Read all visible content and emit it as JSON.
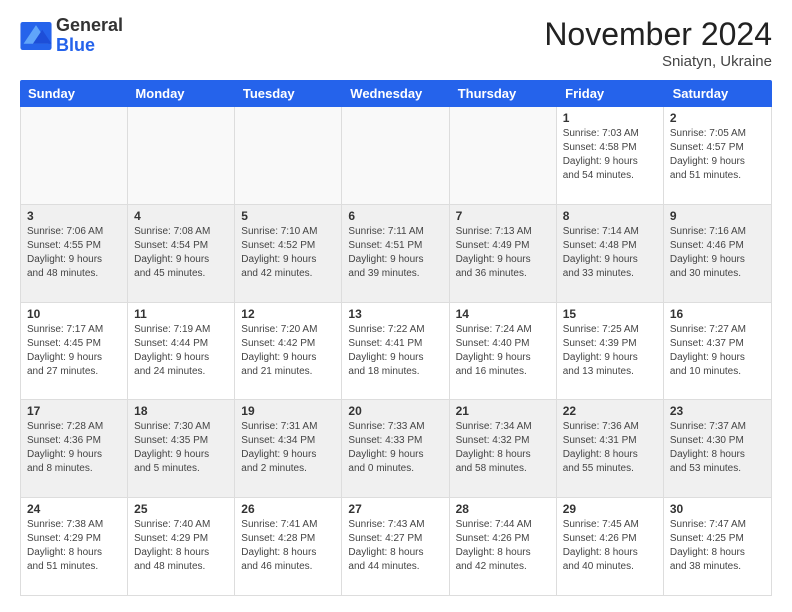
{
  "logo": {
    "line1": "General",
    "line2": "Blue"
  },
  "title": "November 2024",
  "location": "Sniatyn, Ukraine",
  "days_of_week": [
    "Sunday",
    "Monday",
    "Tuesday",
    "Wednesday",
    "Thursday",
    "Friday",
    "Saturday"
  ],
  "weeks": [
    [
      {
        "day": "",
        "info": ""
      },
      {
        "day": "",
        "info": ""
      },
      {
        "day": "",
        "info": ""
      },
      {
        "day": "",
        "info": ""
      },
      {
        "day": "",
        "info": ""
      },
      {
        "day": "1",
        "info": "Sunrise: 7:03 AM\nSunset: 4:58 PM\nDaylight: 9 hours\nand 54 minutes."
      },
      {
        "day": "2",
        "info": "Sunrise: 7:05 AM\nSunset: 4:57 PM\nDaylight: 9 hours\nand 51 minutes."
      }
    ],
    [
      {
        "day": "3",
        "info": "Sunrise: 7:06 AM\nSunset: 4:55 PM\nDaylight: 9 hours\nand 48 minutes."
      },
      {
        "day": "4",
        "info": "Sunrise: 7:08 AM\nSunset: 4:54 PM\nDaylight: 9 hours\nand 45 minutes."
      },
      {
        "day": "5",
        "info": "Sunrise: 7:10 AM\nSunset: 4:52 PM\nDaylight: 9 hours\nand 42 minutes."
      },
      {
        "day": "6",
        "info": "Sunrise: 7:11 AM\nSunset: 4:51 PM\nDaylight: 9 hours\nand 39 minutes."
      },
      {
        "day": "7",
        "info": "Sunrise: 7:13 AM\nSunset: 4:49 PM\nDaylight: 9 hours\nand 36 minutes."
      },
      {
        "day": "8",
        "info": "Sunrise: 7:14 AM\nSunset: 4:48 PM\nDaylight: 9 hours\nand 33 minutes."
      },
      {
        "day": "9",
        "info": "Sunrise: 7:16 AM\nSunset: 4:46 PM\nDaylight: 9 hours\nand 30 minutes."
      }
    ],
    [
      {
        "day": "10",
        "info": "Sunrise: 7:17 AM\nSunset: 4:45 PM\nDaylight: 9 hours\nand 27 minutes."
      },
      {
        "day": "11",
        "info": "Sunrise: 7:19 AM\nSunset: 4:44 PM\nDaylight: 9 hours\nand 24 minutes."
      },
      {
        "day": "12",
        "info": "Sunrise: 7:20 AM\nSunset: 4:42 PM\nDaylight: 9 hours\nand 21 minutes."
      },
      {
        "day": "13",
        "info": "Sunrise: 7:22 AM\nSunset: 4:41 PM\nDaylight: 9 hours\nand 18 minutes."
      },
      {
        "day": "14",
        "info": "Sunrise: 7:24 AM\nSunset: 4:40 PM\nDaylight: 9 hours\nand 16 minutes."
      },
      {
        "day": "15",
        "info": "Sunrise: 7:25 AM\nSunset: 4:39 PM\nDaylight: 9 hours\nand 13 minutes."
      },
      {
        "day": "16",
        "info": "Sunrise: 7:27 AM\nSunset: 4:37 PM\nDaylight: 9 hours\nand 10 minutes."
      }
    ],
    [
      {
        "day": "17",
        "info": "Sunrise: 7:28 AM\nSunset: 4:36 PM\nDaylight: 9 hours\nand 8 minutes."
      },
      {
        "day": "18",
        "info": "Sunrise: 7:30 AM\nSunset: 4:35 PM\nDaylight: 9 hours\nand 5 minutes."
      },
      {
        "day": "19",
        "info": "Sunrise: 7:31 AM\nSunset: 4:34 PM\nDaylight: 9 hours\nand 2 minutes."
      },
      {
        "day": "20",
        "info": "Sunrise: 7:33 AM\nSunset: 4:33 PM\nDaylight: 9 hours\nand 0 minutes."
      },
      {
        "day": "21",
        "info": "Sunrise: 7:34 AM\nSunset: 4:32 PM\nDaylight: 8 hours\nand 58 minutes."
      },
      {
        "day": "22",
        "info": "Sunrise: 7:36 AM\nSunset: 4:31 PM\nDaylight: 8 hours\nand 55 minutes."
      },
      {
        "day": "23",
        "info": "Sunrise: 7:37 AM\nSunset: 4:30 PM\nDaylight: 8 hours\nand 53 minutes."
      }
    ],
    [
      {
        "day": "24",
        "info": "Sunrise: 7:38 AM\nSunset: 4:29 PM\nDaylight: 8 hours\nand 51 minutes."
      },
      {
        "day": "25",
        "info": "Sunrise: 7:40 AM\nSunset: 4:29 PM\nDaylight: 8 hours\nand 48 minutes."
      },
      {
        "day": "26",
        "info": "Sunrise: 7:41 AM\nSunset: 4:28 PM\nDaylight: 8 hours\nand 46 minutes."
      },
      {
        "day": "27",
        "info": "Sunrise: 7:43 AM\nSunset: 4:27 PM\nDaylight: 8 hours\nand 44 minutes."
      },
      {
        "day": "28",
        "info": "Sunrise: 7:44 AM\nSunset: 4:26 PM\nDaylight: 8 hours\nand 42 minutes."
      },
      {
        "day": "29",
        "info": "Sunrise: 7:45 AM\nSunset: 4:26 PM\nDaylight: 8 hours\nand 40 minutes."
      },
      {
        "day": "30",
        "info": "Sunrise: 7:47 AM\nSunset: 4:25 PM\nDaylight: 8 hours\nand 38 minutes."
      }
    ]
  ]
}
